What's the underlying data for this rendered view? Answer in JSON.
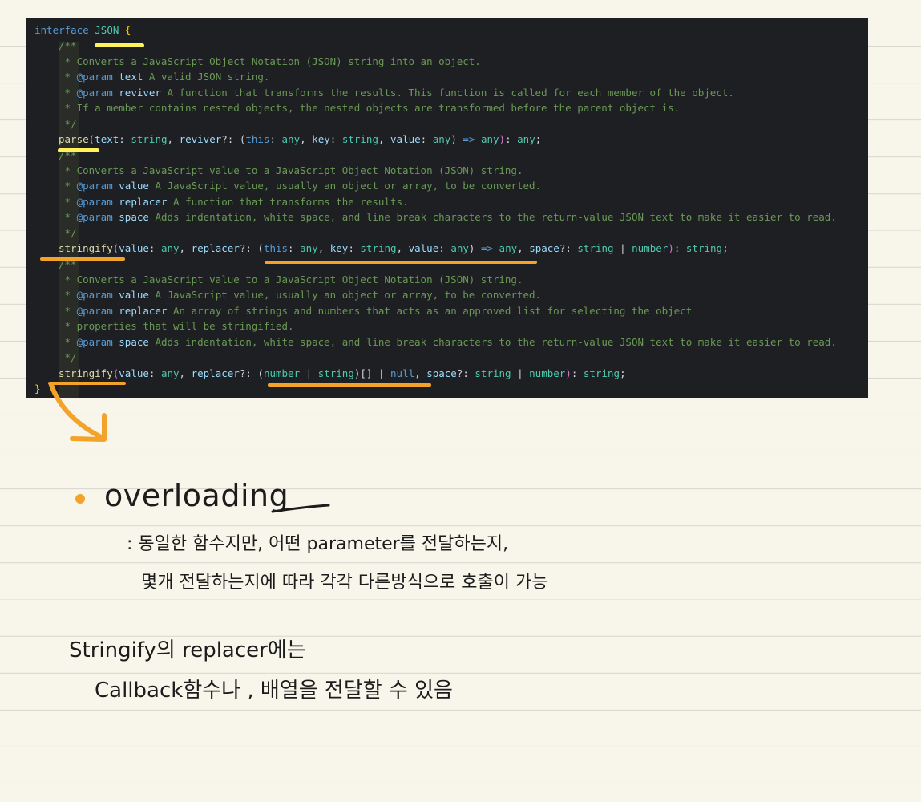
{
  "code": {
    "interface_kw": "interface",
    "interface_name": "JSON",
    "open_brace": "{",
    "close_brace": "}",
    "doc1": {
      "open": "/**",
      "l1": "Converts a JavaScript Object Notation (JSON) string into an object.",
      "l2_tag": "@param",
      "l2_name": "text",
      "l2_desc": "A valid JSON string.",
      "l3_tag": "@param",
      "l3_name": "reviver",
      "l3_desc": "A function that transforms the results. This function is called for each member of the object.",
      "l4": "If a member contains nested objects, the nested objects are transformed before the parent object is.",
      "close": "*/"
    },
    "sig1": {
      "name": "parse",
      "p1": "text",
      "t1": "string",
      "p2": "reviver",
      "cb_this": "this",
      "cb_this_type": "any",
      "cb_key": "key",
      "cb_key_type": "string",
      "cb_value": "value",
      "cb_value_type": "any",
      "cb_ret": "any",
      "ret": "any"
    },
    "doc2": {
      "open": "/**",
      "l1": "Converts a JavaScript value to a JavaScript Object Notation (JSON) string.",
      "l2_tag": "@param",
      "l2_name": "value",
      "l2_desc": "A JavaScript value, usually an object or array, to be converted.",
      "l3_tag": "@param",
      "l3_name": "replacer",
      "l3_desc": "A function that transforms the results.",
      "l4_tag": "@param",
      "l4_name": "space",
      "l4_desc": "Adds indentation, white space, and line break characters to the return-value JSON text to make it easier to read.",
      "close": "*/"
    },
    "sig2": {
      "name": "stringify",
      "p1": "value",
      "t1": "any",
      "p2": "replacer",
      "cb_this": "this",
      "cb_this_type": "any",
      "cb_key": "key",
      "cb_key_type": "string",
      "cb_value": "value",
      "cb_value_type": "any",
      "cb_ret": "any",
      "p3": "space",
      "t3a": "string",
      "t3b": "number",
      "ret": "string"
    },
    "doc3": {
      "open": "/**",
      "l1": "Converts a JavaScript value to a JavaScript Object Notation (JSON) string.",
      "l2_tag": "@param",
      "l2_name": "value",
      "l2_desc": "A JavaScript value, usually an object or array, to be converted.",
      "l3_tag": "@param",
      "l3_name": "replacer",
      "l3_desc": "An array of strings and numbers that acts as an approved list for selecting the object",
      "l4": "properties that will be stringified.",
      "l5_tag": "@param",
      "l5_name": "space",
      "l5_desc": "Adds indentation, white space, and line break characters to the return-value JSON text to make it easier to read.",
      "close": "*/"
    },
    "sig3": {
      "name": "stringify",
      "p1": "value",
      "t1": "any",
      "p2": "replacer",
      "t2a": "number",
      "t2b": "string",
      "t2c": "null",
      "p3": "space",
      "t3a": "string",
      "t3b": "number",
      "ret": "string"
    }
  },
  "notes": {
    "title": "overloading",
    "line1": ": 동일한 함수지만, 어떤 parameter를 전달하는지,",
    "line2": "몇개 전달하는지에 따라 각각  다른방식으로 호출이 가능",
    "line3": "Stringify의 replacer에는",
    "line4": "Callback함수나 , 배열을 전달할 수 있음"
  },
  "colors": {
    "highlight_yellow": "#fff25b",
    "highlight_orange": "#f3a32a",
    "editor_bg": "#1e1f22",
    "paper_bg": "#f8f6ea"
  }
}
